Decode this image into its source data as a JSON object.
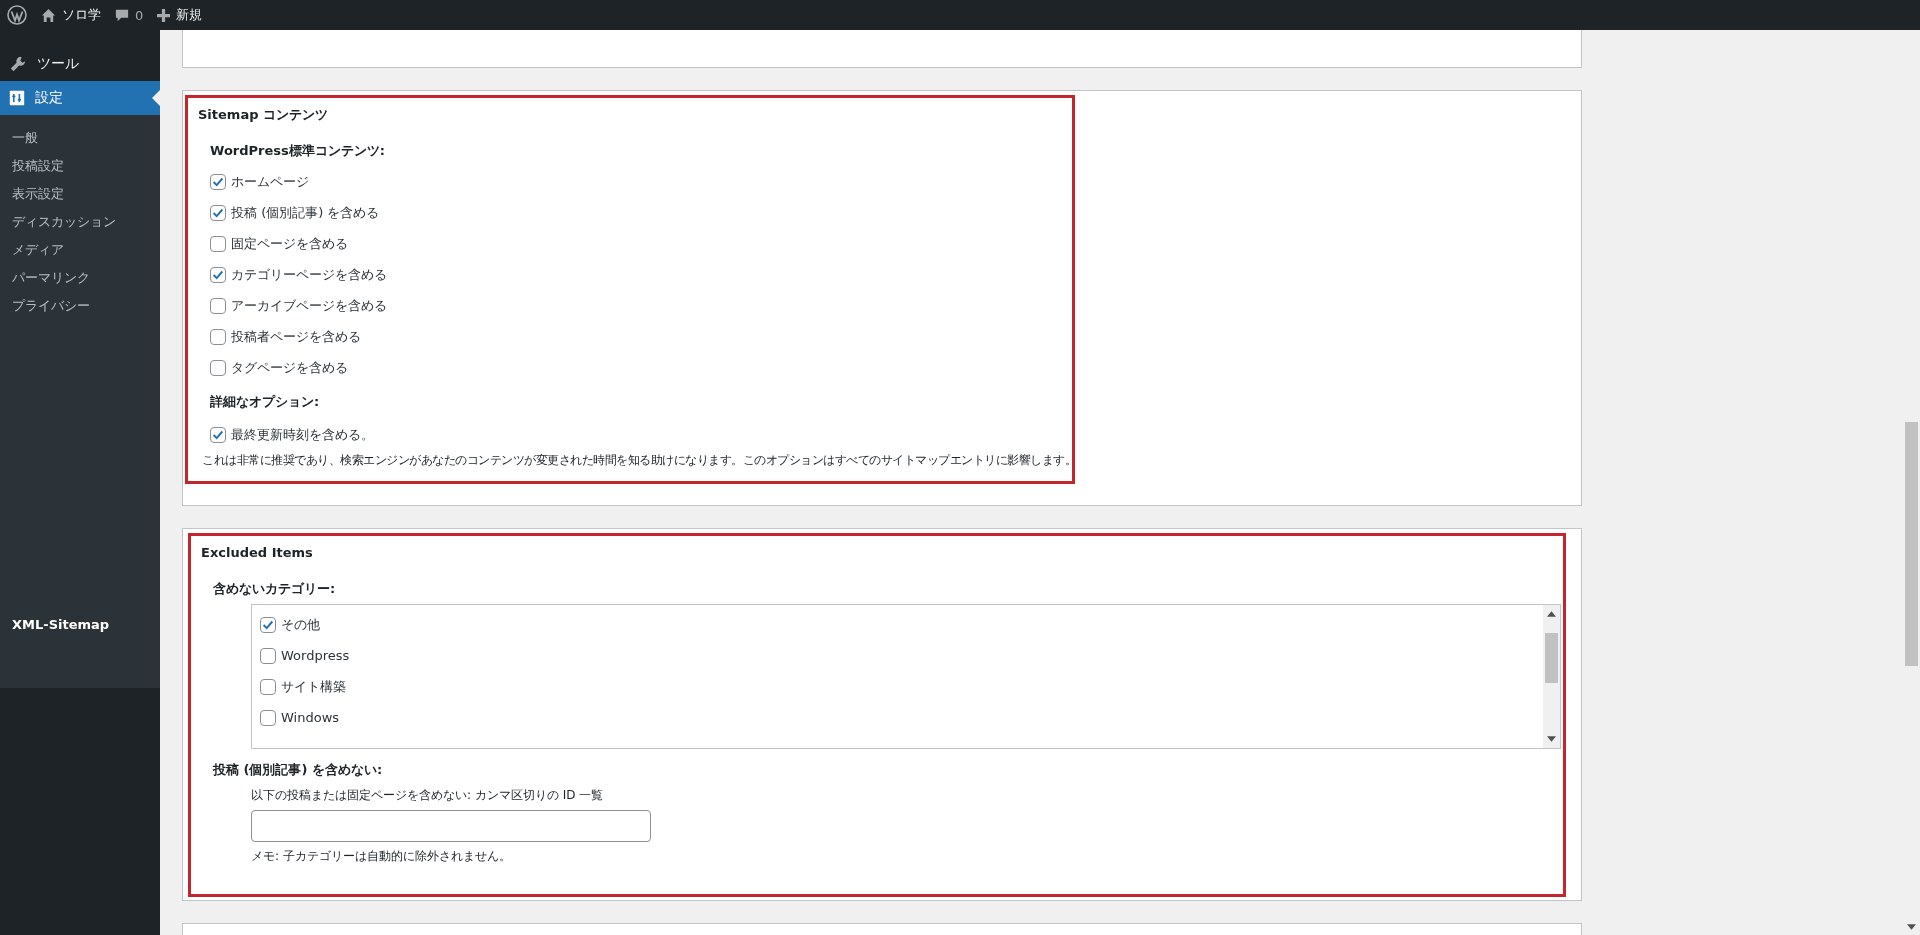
{
  "admin_bar": {
    "site_name": "ソロ学",
    "comments_count": "0",
    "new_label": "新規"
  },
  "sidebar": {
    "items": [
      {
        "kind": "tools",
        "label": "ツール",
        "selected": false
      },
      {
        "kind": "settings",
        "label": "設定",
        "selected": true
      }
    ],
    "submenu": [
      {
        "label": "一般",
        "selected": false
      },
      {
        "label": "投稿設定",
        "selected": false
      },
      {
        "label": "表示設定",
        "selected": false
      },
      {
        "label": "ディスカッション",
        "selected": false
      },
      {
        "label": "メディア",
        "selected": false
      },
      {
        "label": "パーマリンク",
        "selected": false
      },
      {
        "label": "プライバシー",
        "selected": false
      }
    ],
    "plugin_item": {
      "label": "XML-Sitemap",
      "selected": true
    }
  },
  "sitemap_content": {
    "title": "Sitemap コンテンツ",
    "standard_heading": "WordPress標準コンテンツ:",
    "options": [
      {
        "label": "ホームページ",
        "checked": true
      },
      {
        "label": "投稿 (個別記事) を含める",
        "checked": true
      },
      {
        "label": "固定ページを含める",
        "checked": false
      },
      {
        "label": "カテゴリーページを含める",
        "checked": true
      },
      {
        "label": "アーカイブページを含める",
        "checked": false
      },
      {
        "label": "投稿者ページを含める",
        "checked": false
      },
      {
        "label": "タグページを含める",
        "checked": false
      }
    ],
    "advanced_heading": "詳細なオプション:",
    "advanced_options": [
      {
        "label": "最終更新時刻を含める。",
        "checked": true
      }
    ],
    "note": "これは非常に推奨であり、検索エンジンがあなたのコンテンツが変更された時間を知る助けになります。このオプションはすべてのサイトマップエントリに影響します。"
  },
  "excluded_items": {
    "title": "Excluded Items",
    "categories_heading": "含めないカテゴリー:",
    "categories": [
      {
        "label": "その他",
        "checked": true
      },
      {
        "label": "Wordpress",
        "checked": false
      },
      {
        "label": "サイト構築",
        "checked": false
      },
      {
        "label": "Windows",
        "checked": false
      }
    ],
    "posts_heading": "投稿 (個別記事) を含めない:",
    "posts_field_label": "以下の投稿または固定ページを含めない: カンマ区切りの ID 一覧",
    "memo": "メモ: 子カテゴリーは自動的に除外されません。"
  }
}
